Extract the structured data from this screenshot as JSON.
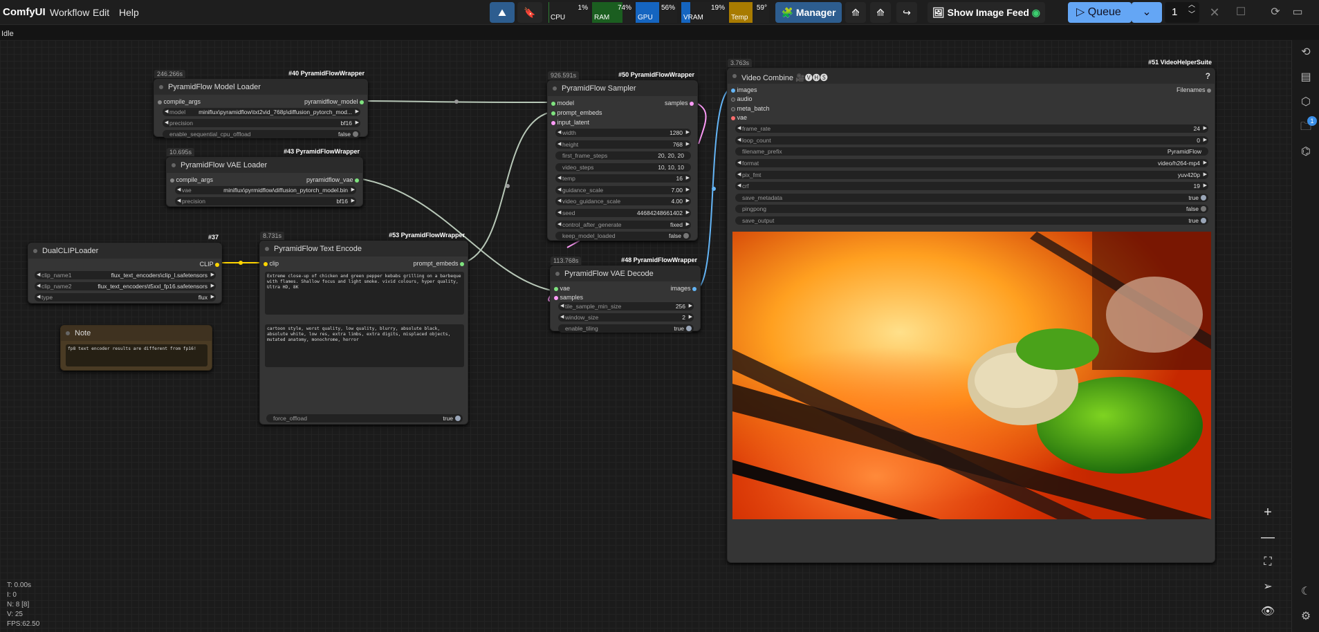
{
  "app": {
    "brand": "ComfyUI",
    "menu": [
      "Workflow",
      "Edit",
      "Help"
    ],
    "status": "Idle"
  },
  "monitors": {
    "cpu": {
      "label": "CPU",
      "value": "1%",
      "level": 0.01
    },
    "ram": {
      "label": "RAM",
      "value": "74%",
      "level": 0.74
    },
    "gpu": {
      "label": "GPU",
      "value": "56%",
      "level": 0.56
    },
    "vram": {
      "label": "VRAM",
      "value": "19%",
      "level": 0.19
    },
    "temp": {
      "label": "Temp",
      "value": "59°",
      "level": 0.59
    }
  },
  "toolbar": {
    "manager": "Manager",
    "image_feed": "Show Image Feed",
    "queue": "Queue",
    "queue_count": "1"
  },
  "right_sidebar": {
    "queue_badge": "1"
  },
  "nodes": {
    "model_loader": {
      "title": "PyramidFlow Model Loader",
      "badge": "#40 PyramidFlowWrapper",
      "timer": "246.266s",
      "in": "compile_args",
      "out": "pyramidflow_model",
      "widgets": [
        {
          "name": "model",
          "value": "miniflux\\pyramidflow\\txt2vid_768p\\diffusion_pytorch_mod..."
        },
        {
          "name": "precision",
          "value": "bf16"
        },
        {
          "name": "enable_sequential_cpu_offload",
          "value": "false"
        }
      ]
    },
    "vae_loader": {
      "title": "PyramidFlow VAE Loader",
      "badge": "#43 PyramidFlowWrapper",
      "timer": "10.695s",
      "in": "compile_args",
      "out": "pyramidflow_vae",
      "widgets": [
        {
          "name": "vae",
          "value": "miniflux\\pyrmidflow\\diffusion_pytorch_model.bin"
        },
        {
          "name": "precision",
          "value": "bf16"
        }
      ]
    },
    "dualclip": {
      "title": "DualCLIPLoader",
      "badge": "#37",
      "out": "CLIP",
      "widgets": [
        {
          "name": "clip_name1",
          "value": "flux_text_encoders\\clip_l.safetensors"
        },
        {
          "name": "clip_name2",
          "value": "flux_text_encoders\\t5xxl_fp16.safetensors"
        },
        {
          "name": "type",
          "value": "flux"
        }
      ]
    },
    "note": {
      "title": "Note",
      "text": "fp8 text encoder results are different from fp16!"
    },
    "text_encode": {
      "title": "PyramidFlow Text Encode",
      "badge": "#53 PyramidFlowWrapper",
      "timer": "8.731s",
      "in": "clip",
      "out": "prompt_embeds",
      "positive": "Extreme close-up of chicken and green pepper kebabs grilling on a barbeque with flames. Shallow focus and light smoke. vivid colours, hyper quality, Ultra HD, 8K",
      "negative": "cartoon style, worst quality, low quality, blurry, absolute black, absolute white, low res, extra limbs, extra digits, misplaced objects, mutated anatomy, monochrome, horror",
      "force_offload": {
        "name": "force_offload",
        "value": "true"
      }
    },
    "sampler": {
      "title": "PyramidFlow Sampler",
      "badge": "#50 PyramidFlowWrapper",
      "timer": "926.591s",
      "inputs": [
        "model",
        "prompt_embeds",
        "input_latent"
      ],
      "out": "samples",
      "widgets": [
        {
          "name": "width",
          "value": "1280"
        },
        {
          "name": "height",
          "value": "768"
        },
        {
          "name": "first_frame_steps",
          "value": "20, 20, 20"
        },
        {
          "name": "video_steps",
          "value": "10, 10, 10"
        },
        {
          "name": "temp",
          "value": "16"
        },
        {
          "name": "guidance_scale",
          "value": "7.00"
        },
        {
          "name": "video_guidance_scale",
          "value": "4.00"
        },
        {
          "name": "seed",
          "value": "44684248661402"
        },
        {
          "name": "control_after_generate",
          "value": "fixed"
        },
        {
          "name": "keep_model_loaded",
          "value": "false"
        }
      ]
    },
    "vae_decode": {
      "title": "PyramidFlow VAE Decode",
      "badge": "#48 PyramidFlowWrapper",
      "timer": "113.768s",
      "inputs": [
        "vae",
        "samples"
      ],
      "out": "images",
      "widgets": [
        {
          "name": "tile_sample_min_size",
          "value": "256"
        },
        {
          "name": "window_size",
          "value": "2"
        },
        {
          "name": "enable_tiling",
          "value": "true"
        }
      ]
    },
    "video_combine": {
      "title": "Video Combine 🎥🅥🅗🅢",
      "badge": "#51 VideoHelperSuite",
      "timer": "3.763s",
      "inputs": [
        "images",
        "audio",
        "meta_batch",
        "vae"
      ],
      "out": "Filenames",
      "help": "?",
      "widgets": [
        {
          "name": "frame_rate",
          "value": "24"
        },
        {
          "name": "loop_count",
          "value": "0"
        },
        {
          "name": "filename_prefix",
          "value": "PyramidFlow"
        },
        {
          "name": "format",
          "value": "video/h264-mp4"
        },
        {
          "name": "pix_fmt",
          "value": "yuv420p"
        },
        {
          "name": "crf",
          "value": "19"
        },
        {
          "name": "save_metadata",
          "value": "true"
        },
        {
          "name": "pingpong",
          "value": "false"
        },
        {
          "name": "save_output",
          "value": "true"
        }
      ]
    }
  },
  "stats": {
    "t": "T: 0.00s",
    "i": "I: 0",
    "n": "N: 8 [8]",
    "v": "V: 25",
    "fps": "FPS:62.50"
  },
  "colors": {
    "model": "#b39ddb",
    "clip": "#ffd500",
    "vae": "#ff6e6e",
    "latent": "#ff9cf9",
    "images": "#64b5f6",
    "prompt": "#7fe37f"
  },
  "icons": {
    "history": "history-icon",
    "queue": "queue-icon",
    "models": "cube-icon",
    "workflows": "folder-icon",
    "nodes": "node-library-icon",
    "theme": "moon-icon",
    "settings": "gear-icon"
  }
}
